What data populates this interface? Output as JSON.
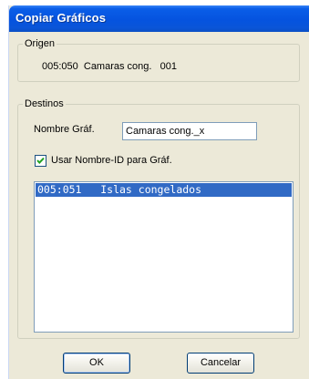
{
  "window": {
    "title": "Copiar Gráficos"
  },
  "origen": {
    "legend": "Origen",
    "value": "005:050  Camaras cong.   001"
  },
  "destinos": {
    "legend": "Destinos",
    "nombre_label": "Nombre Gráf.",
    "nombre_value": "Camaras cong._x",
    "checkbox_label": "Usar Nombre-ID para Gráf.",
    "checkbox_checked": true,
    "list_items": [
      {
        "text": "005:051   Islas congelados",
        "selected": true
      }
    ]
  },
  "buttons": {
    "ok": "OK",
    "cancel": "Cancelar"
  },
  "colors": {
    "titlebar": "#0553df",
    "dialog_bg": "#ece9d8",
    "selection": "#316ac5"
  }
}
